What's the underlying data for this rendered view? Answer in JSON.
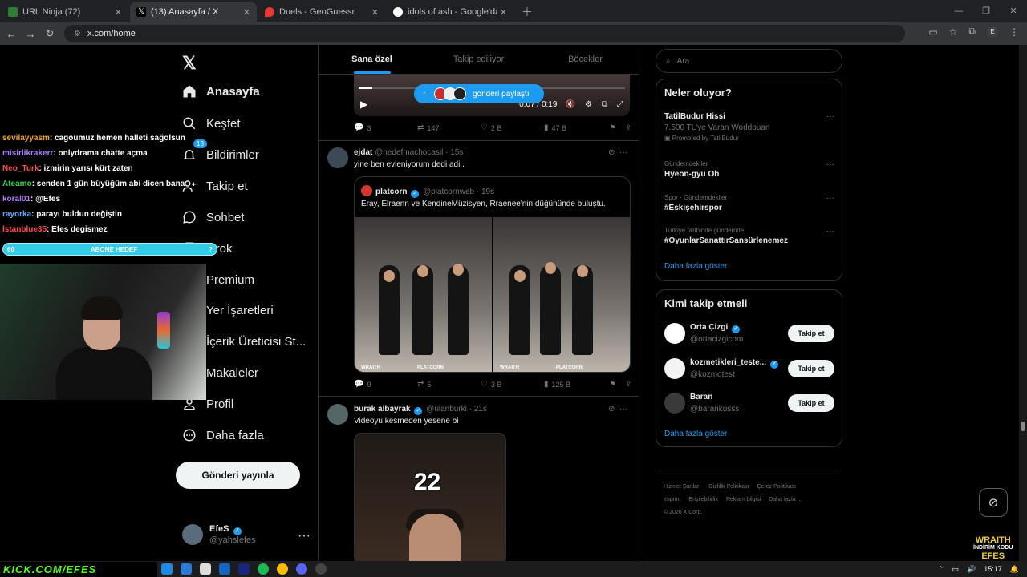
{
  "browser": {
    "tabs": [
      {
        "title": "URL Ninja (72)",
        "color": "#2e7d32"
      },
      {
        "title": "(13) Anasayfa / X",
        "color": "#ffffff"
      },
      {
        "title": "Duels - GeoGuessr",
        "color": "#e53935"
      },
      {
        "title": "idols of ash - Google'da Ara",
        "color": "#ffffff"
      }
    ],
    "url": "x.com/home",
    "profile_initial": "E"
  },
  "nav": {
    "items": [
      {
        "label": "Anasayfa",
        "icon": "home-icon"
      },
      {
        "label": "Keşfet",
        "icon": "search-icon"
      },
      {
        "label": "Bildirimler",
        "icon": "bell-icon",
        "badge": "13"
      },
      {
        "label": "Takip et",
        "icon": "add-user-icon"
      },
      {
        "label": "Sohbet",
        "icon": "chat-icon"
      },
      {
        "label": "Grok",
        "icon": "grok-icon"
      },
      {
        "label": "Premium",
        "icon": "x-premium-icon"
      },
      {
        "label": "Yer İşaretleri",
        "icon": "bookmark-icon"
      },
      {
        "label": "İçerik Üreticisi St...",
        "icon": "creator-icon"
      },
      {
        "label": "Makaleler",
        "icon": "article-icon"
      },
      {
        "label": "Profil",
        "icon": "profile-icon"
      },
      {
        "label": "Daha fazla",
        "icon": "more-icon"
      }
    ],
    "post_button": "Gönderi yayınla",
    "me": {
      "name": "EfeS",
      "handle": "@yahslefes"
    }
  },
  "feed": {
    "tabs": [
      "Sana özel",
      "Takip ediliyor",
      "Böcekler"
    ],
    "share_pill": "gönderi paylaştı",
    "video1": {
      "time": "0:07 / 0:19",
      "progress": 0.05
    },
    "post1_stats": {
      "replies": "3",
      "reposts": "147",
      "likes": "2 B",
      "views": "47 B"
    },
    "post2": {
      "name": "ejdat",
      "handle": "@hedefmachocasil",
      "time": "· 15s",
      "text": "yine ben evleniyorum dedi adi..",
      "quote": {
        "name": "platcorn",
        "handle": "@platcornweb",
        "time": "· 19s",
        "text": "Eray, Elraenn ve KendineMüzisyen, Rraenee'nin düğününde buluştu.",
        "watermark_left": "WRAITH",
        "watermark_right": "PLATCORN"
      },
      "stats": {
        "replies": "9",
        "reposts": "5",
        "likes": "3 B",
        "views": "125 B"
      }
    },
    "post3": {
      "name": "burak albayrak",
      "handle": "@ulanburki",
      "time": "· 21s",
      "text": "Videoyu kesmeden yesene bi",
      "video_number": "22"
    }
  },
  "right": {
    "search_placeholder": "Ara",
    "trends_title": "Neler oluyor?",
    "trends": [
      {
        "context": "",
        "title": "TatilBudur Hissi",
        "sub": "7.500 TL'ye Varan Worldpuan",
        "promo": "Promoted by TatilBudur"
      },
      {
        "context": "Gündemdekiler",
        "title": "Hyeon-gyu Oh"
      },
      {
        "context": "Spor · Gündemdekiler",
        "title": "#Eskişehirspor"
      },
      {
        "context": "Türkiye tarihinde gündemde",
        "title": "#OyunlarSanattırSansürlenemez"
      }
    ],
    "show_more": "Daha fazla göster",
    "who_title": "Kimi takip etmeli",
    "who": [
      {
        "name": "Orta Çizgi",
        "handle": "@ortacizgicom",
        "button": "Takip et",
        "color": "#ffffff"
      },
      {
        "name": "kozmetikleri_teste...",
        "handle": "@kozmotest",
        "button": "Takip et",
        "color": "#f4f4f4"
      },
      {
        "name": "Baran",
        "handle": "@barankusss",
        "button": "Takip et",
        "color": "#3a3a3a"
      }
    ],
    "footer": [
      "Hizmet Şartları",
      "Gizlilik Politikası",
      "Çerez Politikası",
      "Imprint",
      "Erişilebilirlik",
      "Reklam bilgisi",
      "Daha fazla ...",
      "© 2026 X Corp."
    ]
  },
  "stream": {
    "chat": [
      {
        "user": "sevilayyasm",
        "msg": ": cagoumuz hemen halleti sağolsun",
        "color": "#f5a623"
      },
      {
        "user": "misirlikrakerr",
        "msg": ": onlydrama chatte açma",
        "color": "#b07cff"
      },
      {
        "user": "Neo_Turk",
        "msg": ": izmirin yarısı kürt zaten",
        "color": "#ff4d4d"
      },
      {
        "user": "Ateamo",
        "msg": ": senden 1 gün büyüğüm abi dicen bana",
        "color": "#39d353"
      },
      {
        "user": "koral01",
        "msg": ": @Efes",
        "color": "#b07cff"
      },
      {
        "user": "rayorka",
        "msg": ": parayı buldun değiştin",
        "color": "#5aa9ff"
      },
      {
        "user": "İstanblue35",
        "msg": ": Efes degismez",
        "color": "#ff4d4d"
      }
    ],
    "goal": {
      "left": "60",
      "label": "ABONE HEDEF",
      "right": "?"
    },
    "kick": "KICK.COM/EFES",
    "brand": "WRAITH",
    "brand_sub": "İNDİRİM KODU",
    "brand_code": "EFES"
  },
  "taskbar": {
    "time": "15:17"
  }
}
